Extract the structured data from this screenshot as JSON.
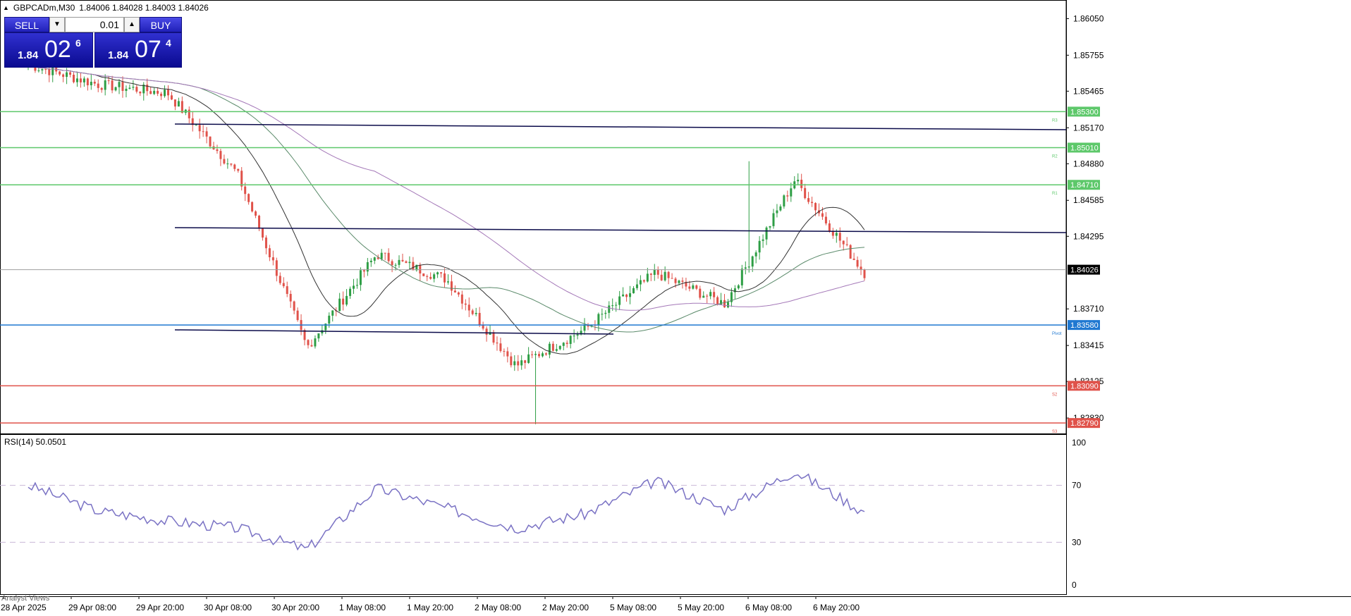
{
  "header": {
    "symbol": "GBPCADm,M30",
    "ohlc": "1.84006 1.84028 1.84003 1.84026"
  },
  "trade_panel": {
    "sell_label": "SELL",
    "buy_label": "BUY",
    "lot": "0.01",
    "sell_small": "1.84",
    "sell_big": "02",
    "sell_sup": "6",
    "buy_small": "1.84",
    "buy_big": "07",
    "buy_sup": "4"
  },
  "rsi_label": "RSI(14) 50.0501",
  "analyst_tab": "Analyst Views",
  "colors": {
    "bull": "#2e9e45",
    "bear": "#e0524a",
    "resistance": "#5dc86a",
    "pivot": "#1f78d1",
    "support": "#e0524a",
    "trendline": "#0b0b4a",
    "rsi": "#7a72c4",
    "ma_fast": "#333333",
    "ma_mid": "#5a8a6a",
    "ma_slow": "#a478b8"
  },
  "price_scale": {
    "ticks": [
      "1.86050",
      "1.85755",
      "1.85465",
      "1.85170",
      "1.84880",
      "1.84585",
      "1.84295",
      "1.83710",
      "1.83415",
      "1.83125",
      "1.82830"
    ],
    "ymin": 1.827,
    "ymax": 1.862
  },
  "levels": [
    {
      "name": "R3",
      "value": 1.853,
      "label": "1.85300",
      "type": "resistance"
    },
    {
      "name": "R2",
      "value": 1.8501,
      "label": "1.85010",
      "type": "resistance"
    },
    {
      "name": "R1",
      "value": 1.8471,
      "label": "1.84710",
      "type": "resistance"
    },
    {
      "name": "Pivot",
      "value": 1.8358,
      "label": "1.83580",
      "type": "pivot"
    },
    {
      "name": "S2",
      "value": 1.8309,
      "label": "1.83090",
      "type": "support"
    },
    {
      "name": "S3",
      "value": 1.8279,
      "label": "1.82790",
      "type": "support"
    }
  ],
  "current_price": {
    "value": 1.84026,
    "label": "1.84026"
  },
  "rsi_scale": {
    "ticks": [
      "100",
      "70",
      "30",
      "0"
    ],
    "overbought": 70,
    "oversold": 30
  },
  "time_axis": [
    "28 Apr 2025",
    "29 Apr 08:00",
    "29 Apr 20:00",
    "30 Apr 08:00",
    "30 Apr 20:00",
    "1 May 08:00",
    "1 May 20:00",
    "2 May 08:00",
    "2 May 20:00",
    "5 May 08:00",
    "5 May 20:00",
    "6 May 08:00",
    "6 May 20:00"
  ],
  "chart_data": {
    "type": "candlestick",
    "symbol": "GBPCADm",
    "timeframe": "M30",
    "close_path": [
      [
        "28 Apr 2025",
        1.8568
      ],
      [
        "29 Apr 08:00",
        1.8552
      ],
      [
        "29 Apr 20:00",
        1.8545
      ],
      [
        "30 Apr 08:00",
        1.848
      ],
      [
        "30 Apr 20:00",
        1.834
      ],
      [
        "1 May 08:00",
        1.8415
      ],
      [
        "1 May 20:00",
        1.8395
      ],
      [
        "2 May 08:00",
        1.8325
      ],
      [
        "2 May 20:00",
        1.8355
      ],
      [
        "5 May 08:00",
        1.84
      ],
      [
        "5 May 20:00",
        1.8375
      ],
      [
        "6 May 08:00",
        1.8475
      ],
      [
        "6 May 20:00",
        1.84
      ]
    ],
    "rsi_path": [
      [
        "28 Apr 2025",
        70
      ],
      [
        "29 Apr 08:00",
        52
      ],
      [
        "29 Apr 20:00",
        45
      ],
      [
        "30 Apr 08:00",
        40
      ],
      [
        "30 Apr 20:00",
        25
      ],
      [
        "1 May 08:00",
        68
      ],
      [
        "1 May 20:00",
        54
      ],
      [
        "2 May 08:00",
        40
      ],
      [
        "2 May 20:00",
        50
      ],
      [
        "5 May 08:00",
        73
      ],
      [
        "5 May 20:00",
        53
      ],
      [
        "6 May 08:00",
        80
      ],
      [
        "6 May 20:00",
        51
      ]
    ]
  }
}
